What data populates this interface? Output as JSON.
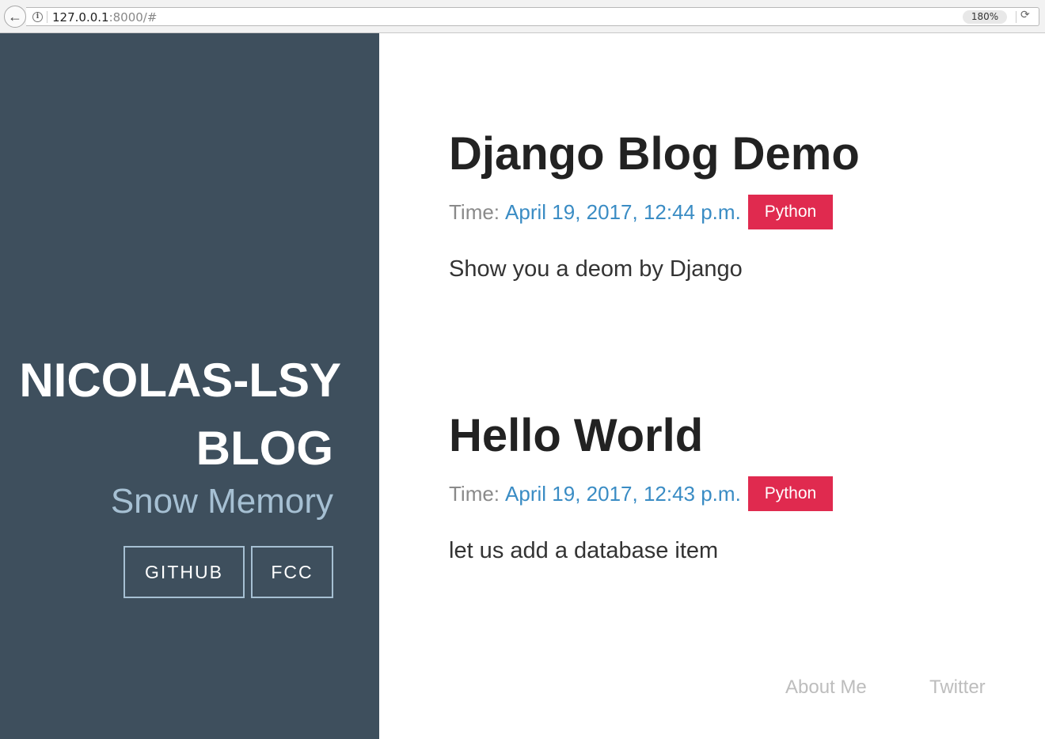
{
  "browser": {
    "url_host": "127.0.0.1",
    "url_rest": ":8000/#",
    "zoom": "180%",
    "icons": {
      "back": "back-arrow-icon",
      "info": "info-icon",
      "reload": "reload-icon"
    }
  },
  "sidebar": {
    "title_line1": "NICOLAS-LSY",
    "title_line2": "BLOG",
    "subtitle": "Snow Memory",
    "buttons": [
      {
        "label": "GITHUB"
      },
      {
        "label": "FCC"
      }
    ],
    "background_color": "#3e4f5d",
    "accent_color": "#a6c0d3"
  },
  "posts": [
    {
      "title": "Django Blog Demo",
      "time_label": "Time:",
      "time": "April 19, 2017, 12:44 p.m.",
      "tag": "Python",
      "excerpt": "Show you a deom by Django"
    },
    {
      "title": "Hello World",
      "time_label": "Time:",
      "time": "April 19, 2017, 12:43 p.m.",
      "tag": "Python",
      "excerpt": "let us add a database item"
    }
  ],
  "footer": {
    "links": [
      {
        "label": "About Me"
      },
      {
        "label": "Twitter"
      }
    ]
  },
  "colors": {
    "tag_badge": "#e02a4f",
    "time_link": "#3a8cc4"
  }
}
